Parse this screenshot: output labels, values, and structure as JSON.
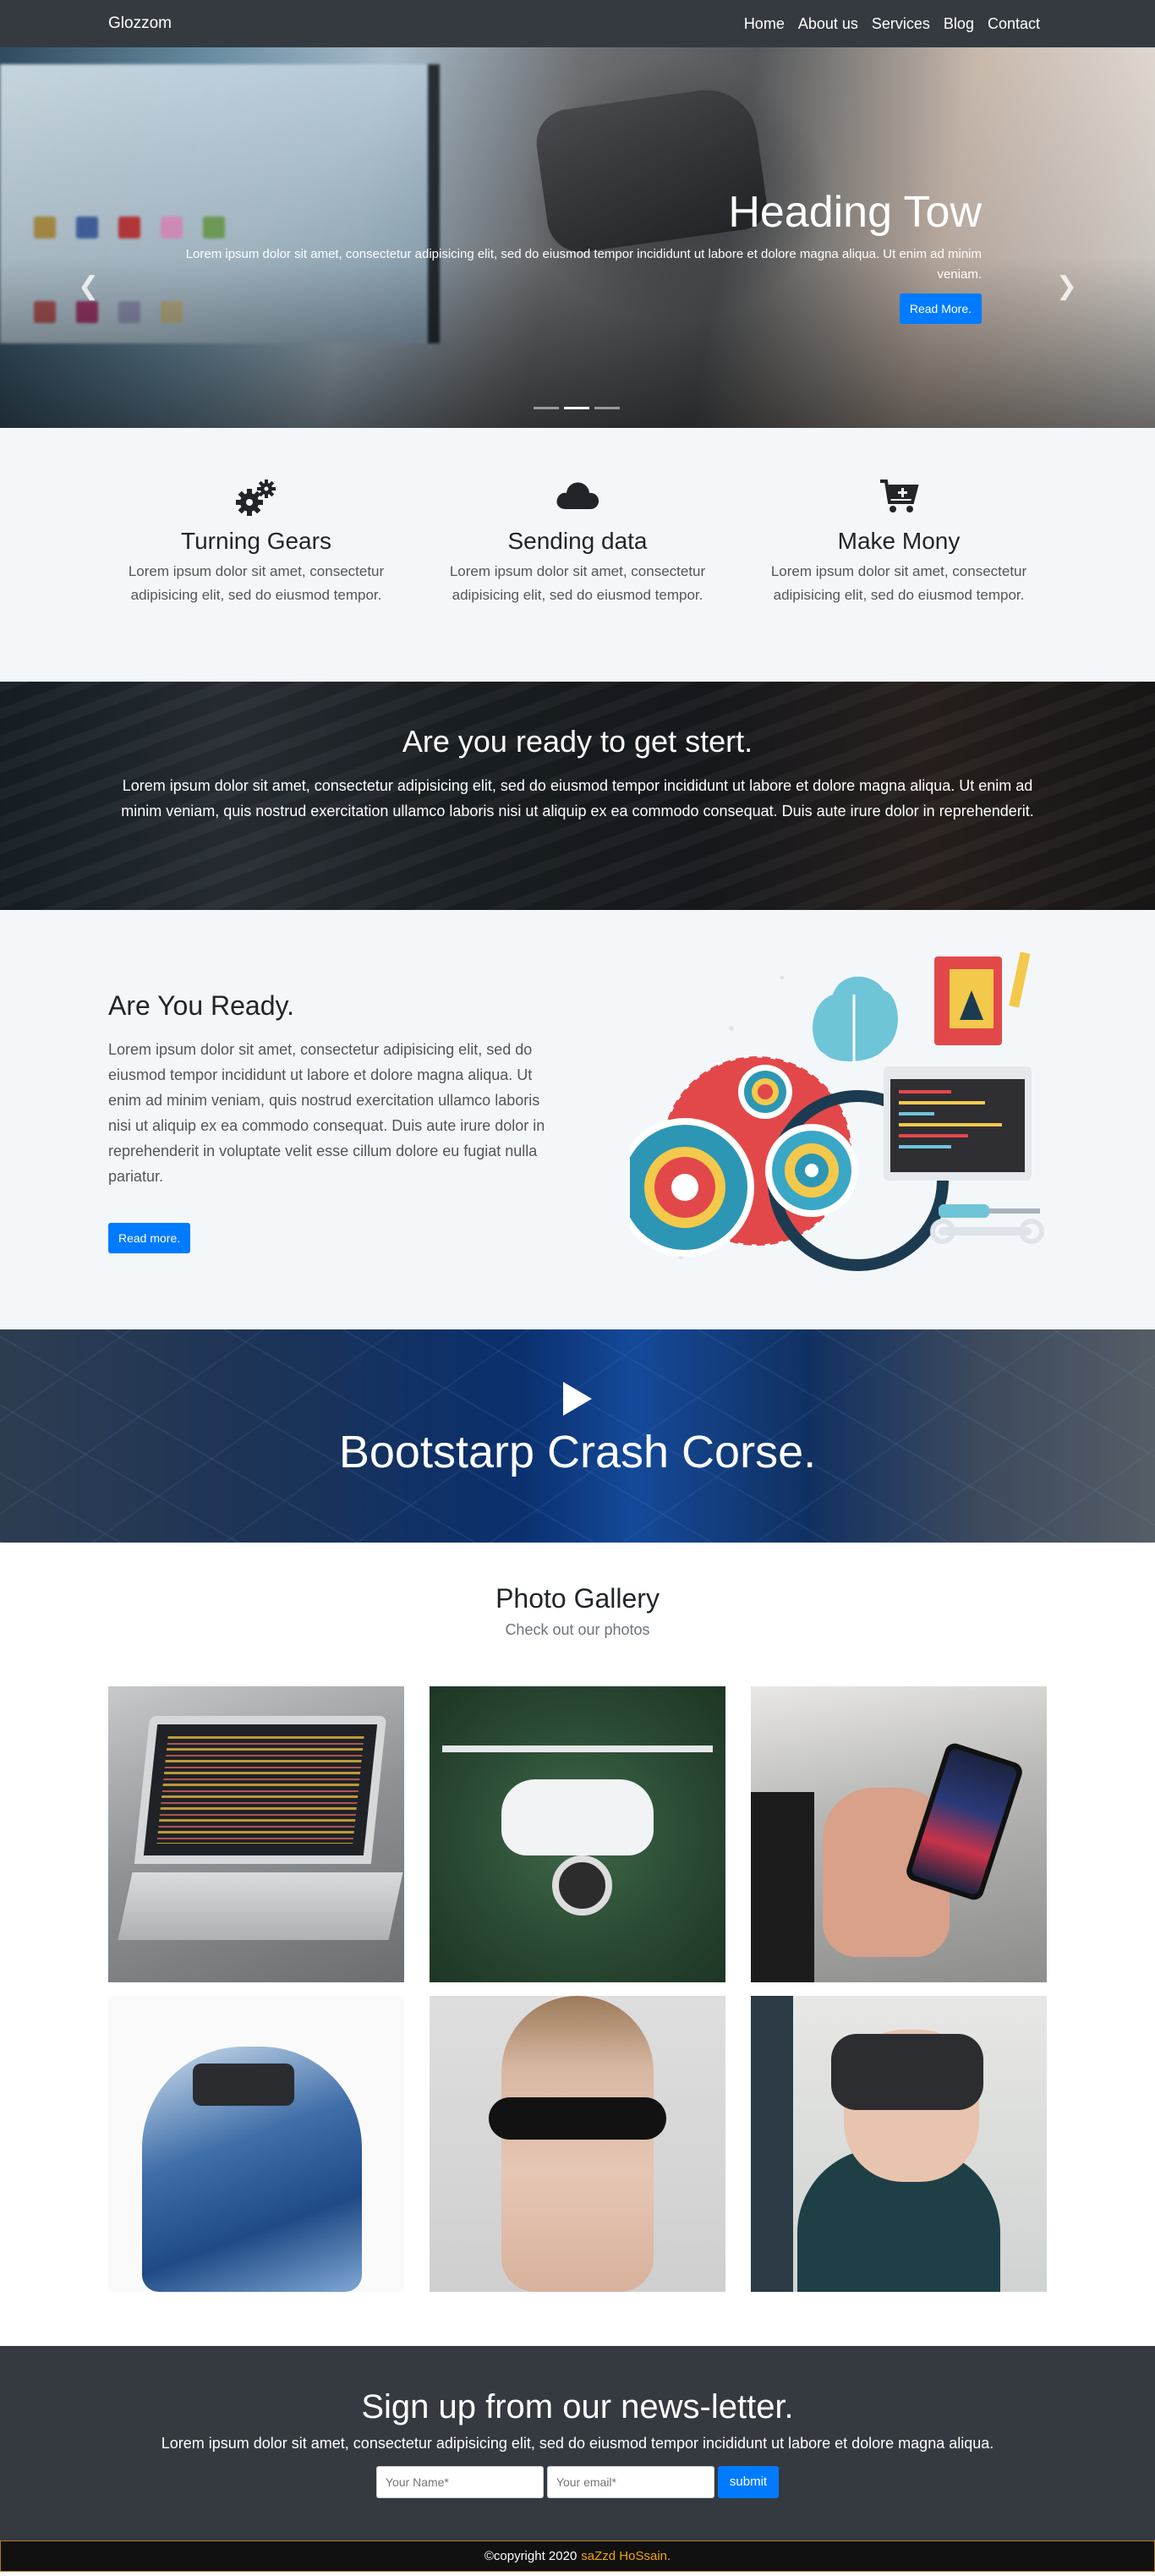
{
  "navbar": {
    "brand": "Glozzom",
    "links": [
      "Home",
      "About us",
      "Services",
      "Blog",
      "Contact"
    ]
  },
  "hero": {
    "heading": "Heading Tow",
    "text": "Lorem ipsum dolor sit amet, consectetur adipisicing elit, sed do eiusmod tempor incididunt ut labore et dolore magna aliqua. Ut enim ad minim veniam.",
    "button": "Read More.",
    "prev_icon": "chevron-left-icon",
    "next_icon": "chevron-right-icon",
    "slide_count": 3,
    "active_slide": 2
  },
  "features": [
    {
      "icon": "gears-icon",
      "title": "Turning Gears",
      "text": "Lorem ipsum dolor sit amet, consectetur adipisicing elit, sed do eiusmod tempor."
    },
    {
      "icon": "cloud-icon",
      "title": "Sending data",
      "text": "Lorem ipsum dolor sit amet, consectetur adipisicing elit, sed do eiusmod tempor."
    },
    {
      "icon": "cart-plus-icon",
      "title": "Make Mony",
      "text": "Lorem ipsum dolor sit amet, consectetur adipisicing elit, sed do eiusmod tempor."
    }
  ],
  "banner": {
    "heading": "Are you ready to get stert.",
    "text": "Lorem ipsum dolor sit amet, consectetur adipisicing elit, sed do eiusmod tempor incididunt ut labore et dolore magna aliqua. Ut enim ad minim veniam, quis nostrud exercitation ullamco laboris nisi ut aliquip ex ea commodo consequat. Duis aute irure dolor in reprehenderit."
  },
  "about": {
    "heading": "Are You Ready.",
    "text": "Lorem ipsum dolor sit amet, consectetur adipisicing elit, sed do eiusmod tempor incididunt ut labore et dolore magna aliqua. Ut enim ad minim veniam, quis nostrud exercitation ullamco laboris nisi ut aliquip ex ea commodo consequat. Duis aute irure dolor in reprehenderit in voluptate velit esse cillum dolore eu fugiat nulla pariatur.",
    "button": "Read more."
  },
  "video": {
    "heading": "Bootstarp Crash Corse.",
    "icon": "play-icon"
  },
  "gallery": {
    "heading": "Photo Gallery",
    "subheading": "Check out our photos",
    "photos": [
      "laptop-code-photo",
      "drone-photo",
      "phone-gadget-photo",
      "vr-pixel-photo",
      "visor-woman-photo",
      "vr-boy-photo"
    ]
  },
  "newsletter": {
    "heading": "Sign up from our news-letter.",
    "text": "Lorem ipsum dolor sit amet, consectetur adipisicing elit, sed do eiusmod tempor incididunt ut labore et dolore magna aliqua.",
    "name_placeholder": "Your Name*",
    "email_placeholder": "Your email*",
    "button": "submit"
  },
  "footer": {
    "copyright": "©copyright 2020",
    "author": "saZzd HoSsain."
  },
  "colors": {
    "dark": "#343a40",
    "primary": "#007bff",
    "light_bg": "#f4f7fa",
    "accent": "#f0a500"
  }
}
